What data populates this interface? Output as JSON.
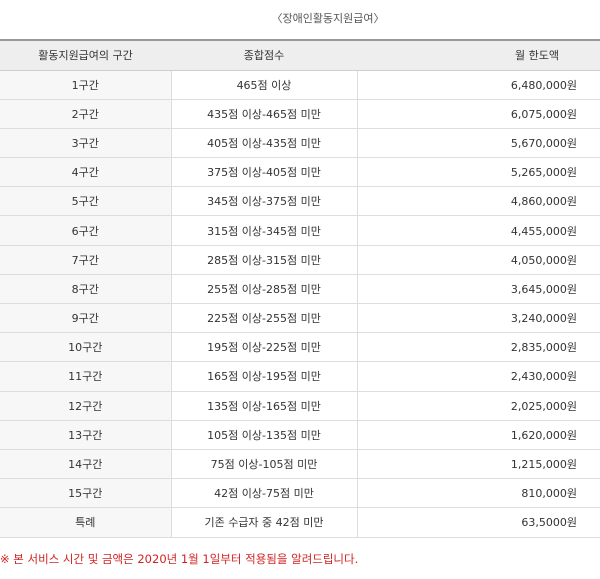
{
  "caption": "〈장애인활동지원급여〉",
  "headers": [
    "활동지원급여의 구간",
    "종합점수",
    "월 한도액"
  ],
  "rows": [
    {
      "tier": "1구간",
      "score": "465점 이상",
      "amount": "6,480,000원"
    },
    {
      "tier": "2구간",
      "score": "435점 이상-465점 미만",
      "amount": "6,075,000원"
    },
    {
      "tier": "3구간",
      "score": "405점 이상-435점 미만",
      "amount": "5,670,000원"
    },
    {
      "tier": "4구간",
      "score": "375점 이상-405점 미만",
      "amount": "5,265,000원"
    },
    {
      "tier": "5구간",
      "score": "345점 이상-375점 미만",
      "amount": "4,860,000원"
    },
    {
      "tier": "6구간",
      "score": "315점 이상-345점 미만",
      "amount": "4,455,000원"
    },
    {
      "tier": "7구간",
      "score": "285점 이상-315점 미만",
      "amount": "4,050,000원"
    },
    {
      "tier": "8구간",
      "score": "255점 이상-285점 미만",
      "amount": "3,645,000원"
    },
    {
      "tier": "9구간",
      "score": "225점 이상-255점 미만",
      "amount": "3,240,000원"
    },
    {
      "tier": "10구간",
      "score": "195점 이상-225점 미만",
      "amount": "2,835,000원"
    },
    {
      "tier": "11구간",
      "score": "165점 이상-195점 미만",
      "amount": "2,430,000원"
    },
    {
      "tier": "12구간",
      "score": "135점 이상-165점 미만",
      "amount": "2,025,000원"
    },
    {
      "tier": "13구간",
      "score": "105점 이상-135점 미만",
      "amount": "1,620,000원"
    },
    {
      "tier": "14구간",
      "score": "75점 이상-105점 미만",
      "amount": "1,215,000원"
    },
    {
      "tier": "15구간",
      "score": "42점 이상-75점 미만",
      "amount": "810,000원"
    },
    {
      "tier": "특례",
      "score": "기존 수급자 중 42점 미만",
      "amount": "63,5000원"
    }
  ],
  "note": "※ 본 서비스 시간 및 금액은 2020년 1월 1일부터 적용됨을 알려드립니다.",
  "colors": {
    "note": "#d22222",
    "header_bg": "#eeeeee",
    "first_col_bg": "#f7f7f7"
  }
}
